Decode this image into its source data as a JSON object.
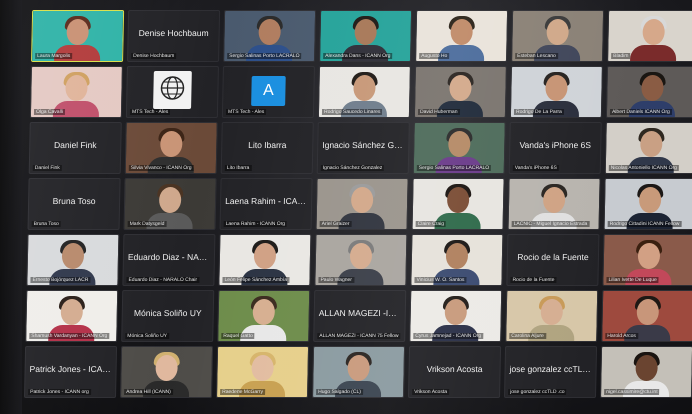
{
  "participants": [
    {
      "name": "Laura Margolis",
      "type": "video",
      "bg": "#2fb3a7",
      "skin": "#c99174",
      "hair": "#5a2a1c",
      "shirt": "#b23b3b"
    },
    {
      "name": "Denise Hochbaum",
      "type": "name",
      "tag": "Denise Hochbaum"
    },
    {
      "name": "Sergio Salinas Porto LACRALO",
      "type": "video",
      "bg": "#4a5a6e",
      "skin": "#b07d5f",
      "hair": "#2a2a2a",
      "shirt": "#2c4f8a"
    },
    {
      "name": "Alexandra Dans - ICANN Org",
      "type": "video",
      "bg": "#25a39a",
      "skin": "#a77858",
      "hair": "#1e1a16",
      "shirt": "#2e2e38"
    },
    {
      "name": "Augusto Ho",
      "type": "video",
      "bg": "#e9e3da",
      "skin": "#c08a68",
      "hair": "#2a2218",
      "shirt": "#4b6c9c"
    },
    {
      "name": "Esteban Lescano",
      "type": "video",
      "bg": "#8a8176",
      "skin": "#d0a889",
      "hair": "#3a3a3a",
      "shirt": "#40465a"
    },
    {
      "name": "Bladim",
      "type": "video",
      "bg": "#d9d4cc",
      "skin": "#d6a88a",
      "hair": "#d8d8d8",
      "shirt": "#7a2b2b"
    },
    {
      "name": "Olga Cavalli",
      "type": "video",
      "bg": "#e4c9c3",
      "skin": "#e0b49a",
      "hair": "#cfa060",
      "shirt": "#c04f6a"
    },
    {
      "name": "MTS Tech - Ales",
      "type": "logo"
    },
    {
      "name": "MTS Tech - Ales",
      "type": "avatar",
      "letter": "A"
    },
    {
      "name": "Rodrigo Saucedo Linares",
      "type": "video",
      "bg": "#e8e6e2",
      "skin": "#c79878",
      "hair": "#1f1a16",
      "shirt": "#6f7d8c"
    },
    {
      "name": "David Huberman",
      "type": "video",
      "bg": "#7a746e",
      "skin": "#d3a98b",
      "hair": "#2a2420",
      "shirt": "#1f2a3a"
    },
    {
      "name": "Rodrigo De La Parra",
      "type": "video",
      "bg": "#cfd3d8",
      "skin": "#c79474",
      "hair": "#262220",
      "shirt": "#2a2e3c"
    },
    {
      "name": "Albert Daniels ICANN Org",
      "type": "video",
      "bg": "#5e5a58",
      "skin": "#8a5c44",
      "hair": "#1a1612",
      "shirt": "#2e3e6a"
    },
    {
      "name": "Daniel Fink",
      "type": "name",
      "tag": "Daniel Fink"
    },
    {
      "name": "Silvia Vivanco - ICANN Org",
      "type": "video",
      "bg": "#6b4a38",
      "skin": "#c99476",
      "hair": "#3c2416",
      "shirt": "#2e2e2e"
    },
    {
      "name": "Lito Ibarra",
      "type": "name",
      "tag": "Lito Ibarra"
    },
    {
      "name": "Ignacio Sánchez Gonzalez",
      "type": "name",
      "tag": "Ignacio Sánchez Gonz..."
    },
    {
      "name": "Sergio Salinas Porto LACRALO",
      "type": "video",
      "bg": "#4d6b5a",
      "skin": "#b58a66",
      "hair": "#2a2a2a",
      "shirt": "#6a3a8a"
    },
    {
      "name": "Vanda's iPhone 6S",
      "type": "name",
      "tag": "Vanda's iPhone 6S"
    },
    {
      "name": "Nicolas Antoniello ICANN Org",
      "type": "video",
      "bg": "#d3cfc8",
      "skin": "#c9a084",
      "hair": "#2e2820",
      "shirt": "#30384a"
    },
    {
      "name": "Bruna Toso",
      "type": "name",
      "tag": "Bruna Toso"
    },
    {
      "name": "Mark Datysgeld",
      "type": "video",
      "bg": "#3c3a36",
      "skin": "#cfa88c",
      "hair": "#4a3322",
      "shirt": "#5a5a5a"
    },
    {
      "name": "Laena Rahim - ICANN Org",
      "type": "name",
      "tag": "Laena Rahim - ICANN ..."
    },
    {
      "name": "Ariel Graizer",
      "type": "video",
      "bg": "#9a948c",
      "skin": "#d2a88a",
      "hair": "#9a9a9a",
      "shirt": "#30343e"
    },
    {
      "name": "Claire Craig",
      "type": "video",
      "bg": "#e7e5e0",
      "skin": "#7a4c34",
      "hair": "#1a1410",
      "shirt": "#2e6a4a"
    },
    {
      "name": "LACNIC - Miguel Ignacio Estrada",
      "type": "video",
      "bg": "#b8b4ae",
      "skin": "#cfa384",
      "hair": "#2a2622",
      "shirt": "#e0e0e0"
    },
    {
      "name": "Rodrigo Cittadini ICANN Fellow",
      "type": "video",
      "bg": "#c7cbd0",
      "skin": "#c89a7a",
      "hair": "#1c1816",
      "shirt": "#1c2434"
    },
    {
      "name": "Ernesto Bojórquez LACR",
      "type": "video",
      "bg": "#d8dadc",
      "skin": "#b88a6c",
      "hair": "#222",
      "shirt": "#30384c"
    },
    {
      "name": "Eduardo Diaz - NARALO Chair",
      "type": "name",
      "tag": "Eduardo Diaz - NARAL..."
    },
    {
      "name": "León Felipe Sánchez Ambía",
      "type": "video",
      "bg": "#e9e7e3",
      "skin": "#d0a084",
      "hair": "#1c1a18",
      "shirt": "#2a3242"
    },
    {
      "name": "Paulo Wagner",
      "type": "video",
      "bg": "#a9a59f",
      "skin": "#d4ab8e",
      "hair": "#7a7a7a",
      "shirt": "#3a3e48"
    },
    {
      "name": "Vinicius W. O. Santos",
      "type": "video",
      "bg": "#e6e2da",
      "skin": "#b0805e",
      "hair": "#1a1614",
      "shirt": "#3a4a70"
    },
    {
      "name": "Rocio de la Fuente",
      "type": "name",
      "tag": "Rocio de la Fuente"
    },
    {
      "name": "Lilian Ivette De Luque",
      "type": "video",
      "bg": "#8a5a4a",
      "skin": "#d2a084",
      "hair": "#3a2010",
      "shirt": "#c2485a"
    },
    {
      "name": "Shamush Vardanyan - ICANN Org",
      "type": "video",
      "bg": "#f0eeea",
      "skin": "#d4ac90",
      "hair": "#2a1e18",
      "shirt": "#b43048"
    },
    {
      "name": "Mónica Soliño UY",
      "type": "name",
      "tag": "Mónica Soliño UY"
    },
    {
      "name": "Raquel Gatto",
      "type": "video",
      "bg": "#6d8c4a",
      "skin": "#d6ae90",
      "hair": "#3a2a1e",
      "shirt": "#e8e8e8"
    },
    {
      "name": "ALLAN MAGEZI - ICANN 75 Fellow",
      "type": "name",
      "tag": "ALLAN MAGEZI -Icann..."
    },
    {
      "name": "Cyrus Jamnejad - ICANN Org",
      "type": "video",
      "bg": "#eceae6",
      "skin": "#c89a7c",
      "hair": "#221c18",
      "shirt": "#2a3048"
    },
    {
      "name": "Carolina Aljure",
      "type": "video",
      "bg": "#d7c7a8",
      "skin": "#d6ae92",
      "hair": "#c89a58",
      "shirt": "#b0a480"
    },
    {
      "name": "Harold Arcos",
      "type": "video",
      "bg": "#9e4a3e",
      "skin": "#c8967a",
      "hair": "#1e1814",
      "shirt": "#3a3a48"
    },
    {
      "name": "Patrick Jones - ICANN org",
      "type": "name",
      "tag": "Patrick Jones - ICANN..."
    },
    {
      "name": "Andrea Hill (ICANN)",
      "type": "video",
      "bg": "#4e4c48",
      "skin": "#e0b89e",
      "hair": "#d0b070",
      "shirt": "#2a2a2a"
    },
    {
      "name": "Raedene McGarry",
      "type": "video",
      "bg": "#e6cf8a",
      "skin": "#e2bca0",
      "hair": "#d6b46a",
      "shirt": "#c8a050"
    },
    {
      "name": "Hugo Salgado (CL)",
      "type": "video",
      "bg": "#8a9aa0",
      "skin": "#c99a7c",
      "hair": "#2a2420",
      "shirt": "#3a4450"
    },
    {
      "name": "Vrikson Acosta",
      "type": "name",
      "tag": "Vrikson Acosta"
    },
    {
      "name": "jose gonzalez ccTLD .co",
      "type": "name",
      "tag": "jose gonzalez ccTLD .co"
    },
    {
      "name": "nigel.cassimire@ctu.int",
      "type": "video",
      "bg": "#c4c0b8",
      "skin": "#6a4430",
      "hair": "#1a1410",
      "shirt": "#e8e8e8"
    }
  ]
}
